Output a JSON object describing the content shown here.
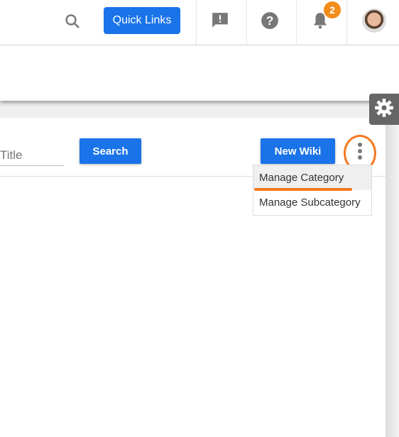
{
  "header": {
    "quick_links_label": "Quick Links",
    "notification_count": "2",
    "icons": [
      "search-icon",
      "feedback-icon",
      "help-icon",
      "bell-icon",
      "avatar"
    ]
  },
  "toolbar": {
    "title_placeholder": "Title",
    "search_label": "Search",
    "new_wiki_label": "New Wiki"
  },
  "menu": {
    "items": [
      {
        "label": "Manage Category",
        "highlighted": true
      },
      {
        "label": "Manage Subcategory"
      }
    ]
  },
  "colors": {
    "accent": "#1a73e8",
    "annotation": "#f47a20",
    "badge": "#f28c1b"
  }
}
